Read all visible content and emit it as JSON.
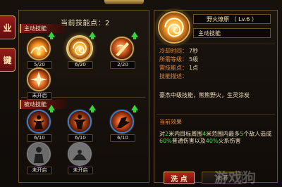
{
  "left_tabs": [
    "业",
    "键"
  ],
  "panel": {
    "points_label": "当前技能点：2",
    "active_section": "主动技能",
    "passive_section": "被动技能"
  },
  "active_skills": [
    {
      "icon": "fire-wave-icon",
      "level": "5/20",
      "upgradable": true,
      "selected": false
    },
    {
      "icon": "fire-vortex-icon",
      "level": "6/20",
      "upgradable": true,
      "selected": true
    },
    {
      "icon": "flame-slash-icon",
      "level": "2/20",
      "upgradable": true,
      "selected": false
    },
    {
      "icon": "flame-burst-icon",
      "level": "未开启",
      "upgradable": false,
      "selected": false
    }
  ],
  "passive_skills": [
    {
      "icon": "figure-aura-icon",
      "level": "6/10",
      "upgradable": true
    },
    {
      "icon": "fist-fire-icon",
      "level": "6/10",
      "upgradable": true
    },
    {
      "icon": "flame-hand-icon",
      "level": "6/10",
      "upgradable": true
    },
    {
      "icon": "silhouette-locked-icon",
      "level": "未开启",
      "upgradable": false
    },
    {
      "icon": "shadow-locked-icon",
      "level": "未开启",
      "upgradable": false
    }
  ],
  "detail": {
    "name": "野火燎原 （ Lv.6 ）",
    "type": "主动技能",
    "cooldown_label": "冷却时间：",
    "cooldown_value": "7秒",
    "req_level_label": "所需等级：",
    "req_level_value": "5级",
    "req_points_label": "需技能点：",
    "req_points_value": "1点",
    "desc_label": "技能描述：",
    "description": "豪杰中级技能，熊熊野火，生灵涂炭",
    "effect_title": "当前效果",
    "effect_parts": [
      "对",
      "2",
      "米内目标周围",
      "4",
      "米范围内最多",
      "5",
      "个敌人造成",
      "60%",
      "普通伤害以及",
      "40%",
      "火系伤害"
    ]
  },
  "buttons": {
    "wash": "洗 点",
    "locked": "未 开"
  },
  "watermark": "游戏狗",
  "colors": {
    "accent_gold": "#c9a45a",
    "upgrade_green": "#38d23a",
    "label_orange": "#e58b3a",
    "highlight_green": "#3fe04a"
  }
}
